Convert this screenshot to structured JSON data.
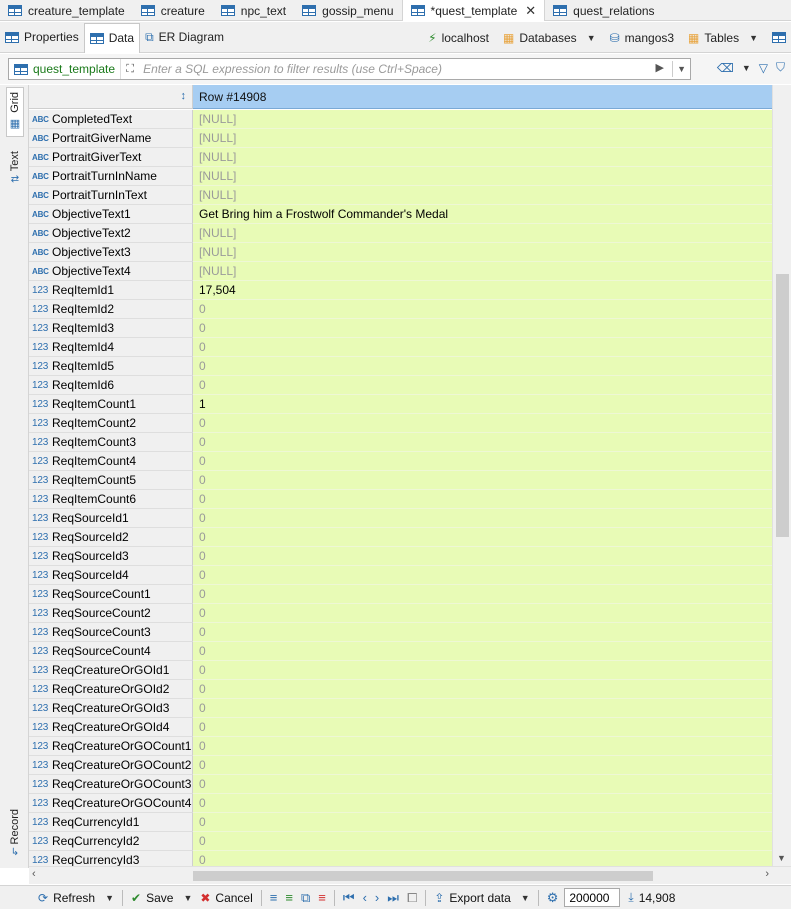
{
  "editor_tabs": [
    {
      "label": "creature_template",
      "active": false
    },
    {
      "label": "creature",
      "active": false
    },
    {
      "label": "npc_text",
      "active": false
    },
    {
      "label": "gossip_menu",
      "active": false
    },
    {
      "label": "*quest_template",
      "active": true
    },
    {
      "label": "quest_relations",
      "active": false
    }
  ],
  "sub_tabs": {
    "properties": "Properties",
    "data": "Data",
    "er_diagram": "ER Diagram"
  },
  "connection": {
    "host": "localhost",
    "databases": "Databases",
    "schema": "mangos3",
    "tables": "Tables"
  },
  "filter": {
    "table": "quest_template",
    "placeholder": "Enter a SQL expression to filter results (use Ctrl+Space)"
  },
  "side_tabs": {
    "grid": "Grid",
    "text": "Text",
    "record": "Record"
  },
  "grid": {
    "header": "Row  #14908",
    "rows": [
      {
        "name": "CompletedText",
        "type": "ABC",
        "value": "[NULL]",
        "null": true
      },
      {
        "name": "PortraitGiverName",
        "type": "ABC",
        "value": "[NULL]",
        "null": true
      },
      {
        "name": "PortraitGiverText",
        "type": "ABC",
        "value": "[NULL]",
        "null": true
      },
      {
        "name": "PortraitTurnInName",
        "type": "ABC",
        "value": "[NULL]",
        "null": true
      },
      {
        "name": "PortraitTurnInText",
        "type": "ABC",
        "value": "[NULL]",
        "null": true
      },
      {
        "name": "ObjectiveText1",
        "type": "ABC",
        "value": "Get Bring him a Frostwolf Commander's Medal",
        "null": false
      },
      {
        "name": "ObjectiveText2",
        "type": "ABC",
        "value": "[NULL]",
        "null": true
      },
      {
        "name": "ObjectiveText3",
        "type": "ABC",
        "value": "[NULL]",
        "null": true
      },
      {
        "name": "ObjectiveText4",
        "type": "ABC",
        "value": "[NULL]",
        "null": true
      },
      {
        "name": "ReqItemId1",
        "type": "123",
        "value": "17,504",
        "null": false
      },
      {
        "name": "ReqItemId2",
        "type": "123",
        "value": "0",
        "null": true
      },
      {
        "name": "ReqItemId3",
        "type": "123",
        "value": "0",
        "null": true
      },
      {
        "name": "ReqItemId4",
        "type": "123",
        "value": "0",
        "null": true
      },
      {
        "name": "ReqItemId5",
        "type": "123",
        "value": "0",
        "null": true
      },
      {
        "name": "ReqItemId6",
        "type": "123",
        "value": "0",
        "null": true
      },
      {
        "name": "ReqItemCount1",
        "type": "123",
        "value": "1",
        "null": false
      },
      {
        "name": "ReqItemCount2",
        "type": "123",
        "value": "0",
        "null": true
      },
      {
        "name": "ReqItemCount3",
        "type": "123",
        "value": "0",
        "null": true
      },
      {
        "name": "ReqItemCount4",
        "type": "123",
        "value": "0",
        "null": true
      },
      {
        "name": "ReqItemCount5",
        "type": "123",
        "value": "0",
        "null": true
      },
      {
        "name": "ReqItemCount6",
        "type": "123",
        "value": "0",
        "null": true
      },
      {
        "name": "ReqSourceId1",
        "type": "123",
        "value": "0",
        "null": true
      },
      {
        "name": "ReqSourceId2",
        "type": "123",
        "value": "0",
        "null": true
      },
      {
        "name": "ReqSourceId3",
        "type": "123",
        "value": "0",
        "null": true
      },
      {
        "name": "ReqSourceId4",
        "type": "123",
        "value": "0",
        "null": true
      },
      {
        "name": "ReqSourceCount1",
        "type": "123",
        "value": "0",
        "null": true
      },
      {
        "name": "ReqSourceCount2",
        "type": "123",
        "value": "0",
        "null": true
      },
      {
        "name": "ReqSourceCount3",
        "type": "123",
        "value": "0",
        "null": true
      },
      {
        "name": "ReqSourceCount4",
        "type": "123",
        "value": "0",
        "null": true
      },
      {
        "name": "ReqCreatureOrGOId1",
        "type": "123",
        "value": "0",
        "null": true
      },
      {
        "name": "ReqCreatureOrGOId2",
        "type": "123",
        "value": "0",
        "null": true
      },
      {
        "name": "ReqCreatureOrGOId3",
        "type": "123",
        "value": "0",
        "null": true
      },
      {
        "name": "ReqCreatureOrGOId4",
        "type": "123",
        "value": "0",
        "null": true
      },
      {
        "name": "ReqCreatureOrGOCount1",
        "type": "123",
        "value": "0",
        "null": true
      },
      {
        "name": "ReqCreatureOrGOCount2",
        "type": "123",
        "value": "0",
        "null": true
      },
      {
        "name": "ReqCreatureOrGOCount3",
        "type": "123",
        "value": "0",
        "null": true
      },
      {
        "name": "ReqCreatureOrGOCount4",
        "type": "123",
        "value": "0",
        "null": true
      },
      {
        "name": "ReqCurrencyId1",
        "type": "123",
        "value": "0",
        "null": true
      },
      {
        "name": "ReqCurrencyId2",
        "type": "123",
        "value": "0",
        "null": true
      },
      {
        "name": "ReqCurrencyId3",
        "type": "123",
        "value": "0",
        "null": true
      }
    ]
  },
  "bottom": {
    "refresh": "Refresh",
    "save": "Save",
    "cancel": "Cancel",
    "export": "Export data",
    "limit": "200000",
    "row_count": "14,908"
  },
  "colors": {
    "value_bg": "#e8fbb6",
    "header_bg": "#a6cdf2",
    "accent": "#2e6fae"
  }
}
